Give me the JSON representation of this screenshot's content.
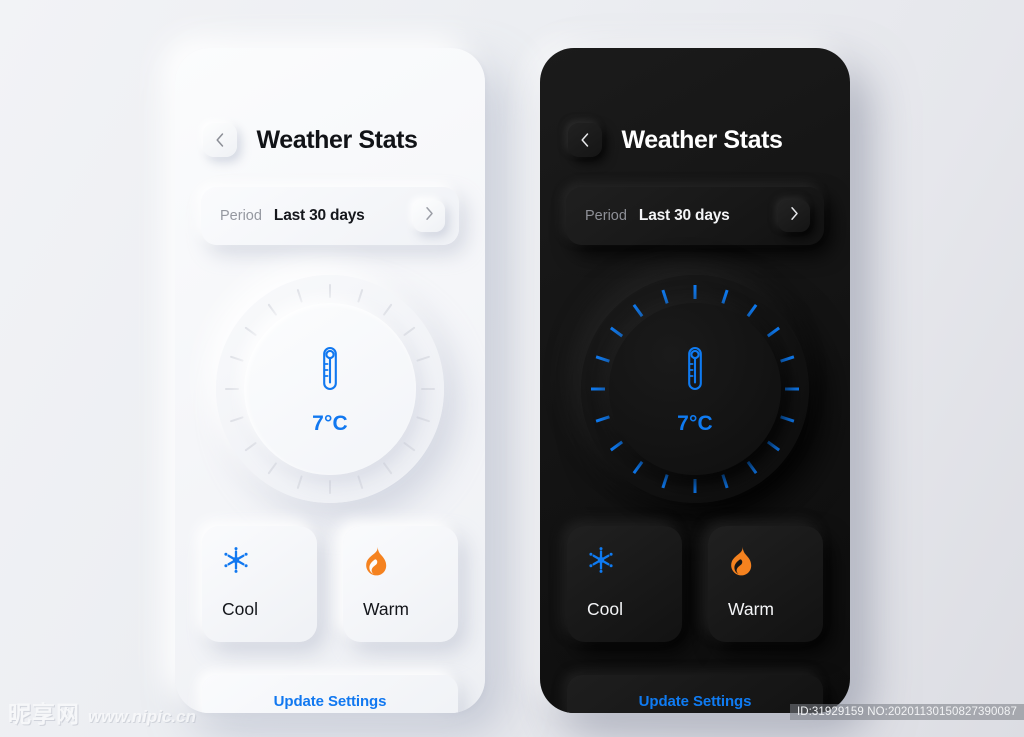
{
  "app": {
    "title": "Weather Stats"
  },
  "icons": {
    "back": "chevron-left-icon",
    "forward": "chevron-right-icon",
    "thermometer": "thermometer-icon",
    "snowflake": "snowflake-icon",
    "flame": "flame-icon"
  },
  "colors": {
    "accent_blue": "#0f7bf2",
    "light_accent_blue": "#1178f0",
    "warm_orange": "#f5821f",
    "light_bg": "#f5f6f9",
    "dark_bg": "#141414",
    "light_text": "#111317",
    "dark_text": "#ffffff",
    "muted_text": "#9598a0"
  },
  "period": {
    "label": "Period",
    "value": "Last 30 days"
  },
  "dial": {
    "temperature": "7°C",
    "tick_count": 20
  },
  "modes": [
    {
      "id": "cool",
      "label": "Cool",
      "icon": "snowflake-icon",
      "color": "#1178f0"
    },
    {
      "id": "warm",
      "label": "Warm",
      "icon": "flame-icon",
      "color": "#f5821f"
    }
  ],
  "actions": {
    "update_settings": "Update Settings"
  },
  "watermark": {
    "brand_cn": "昵享网",
    "url": "www.nipic.cn",
    "id_line": "ID:31929159 NO:20201130150827390087"
  },
  "themes": {
    "light": {
      "name": "light"
    },
    "dark": {
      "name": "dark"
    }
  }
}
